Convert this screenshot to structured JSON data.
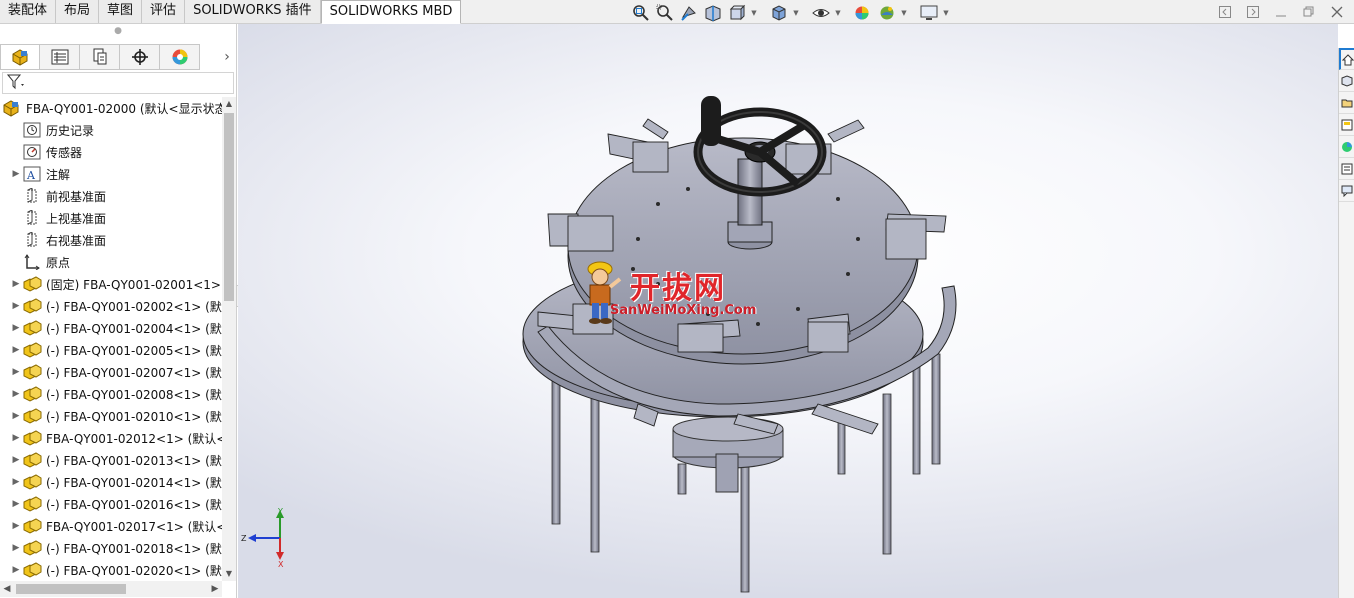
{
  "top_tabs": [
    {
      "label": "装配体",
      "active": false
    },
    {
      "label": "布局",
      "active": false
    },
    {
      "label": "草图",
      "active": false
    },
    {
      "label": "评估",
      "active": false
    },
    {
      "label": "SOLIDWORKS 插件",
      "active": false
    },
    {
      "label": "SOLIDWORKS MBD",
      "active": true
    }
  ],
  "heads_up_icons": [
    "zoom-to-fit-icon",
    "zoom-to-area-icon",
    "previous-view-icon",
    "section-view-icon",
    "view-orientation-icon",
    "display-style-icon",
    "hide-show-icon",
    "edit-appearance-icon",
    "apply-scene-icon",
    "view-settings-icon"
  ],
  "window_controls": [
    "tile-left-icon",
    "tile-right-icon",
    "minimize-icon",
    "restore-icon",
    "close-icon"
  ],
  "panel_tabs": [
    "featuremanager-icon",
    "propertymanager-icon",
    "configurationmanager-icon",
    "dimxpertmanager-icon",
    "displaymanager-icon"
  ],
  "tree": {
    "root": "FBA-QY001-02000  (默认<显示状态",
    "items": [
      {
        "label": "历史记录",
        "icon": "history-icon",
        "expandable": false
      },
      {
        "label": "传感器",
        "icon": "sensor-icon",
        "expandable": false
      },
      {
        "label": "注解",
        "icon": "annotation-icon",
        "expandable": true
      },
      {
        "label": "前视基准面",
        "icon": "plane-icon",
        "expandable": false
      },
      {
        "label": "上视基准面",
        "icon": "plane-icon",
        "expandable": false
      },
      {
        "label": "右视基准面",
        "icon": "plane-icon",
        "expandable": false
      },
      {
        "label": "原点",
        "icon": "origin-icon",
        "expandable": false
      },
      {
        "label": "(固定) FBA-QY001-02001<1> (",
        "icon": "subassembly-icon",
        "expandable": true
      },
      {
        "label": "(-) FBA-QY001-02002<1> (默认",
        "icon": "subassembly-icon",
        "expandable": true
      },
      {
        "label": "(-) FBA-QY001-02004<1> (默认",
        "icon": "subassembly-icon",
        "expandable": true
      },
      {
        "label": "(-) FBA-QY001-02005<1> (默认",
        "icon": "subassembly-icon",
        "expandable": true
      },
      {
        "label": "(-) FBA-QY001-02007<1> (默认",
        "icon": "subassembly-icon",
        "expandable": true
      },
      {
        "label": "(-) FBA-QY001-02008<1> (默认",
        "icon": "subassembly-icon",
        "expandable": true
      },
      {
        "label": "(-) FBA-QY001-02010<1> (默认",
        "icon": "subassembly-icon",
        "expandable": true
      },
      {
        "label": "FBA-QY001-02012<1> (默认<",
        "icon": "subassembly-icon",
        "expandable": true
      },
      {
        "label": "(-) FBA-QY001-02013<1> (默认",
        "icon": "subassembly-icon",
        "expandable": true
      },
      {
        "label": "(-) FBA-QY001-02014<1> (默认",
        "icon": "subassembly-icon",
        "expandable": true
      },
      {
        "label": "(-) FBA-QY001-02016<1> (默认",
        "icon": "subassembly-icon",
        "expandable": true
      },
      {
        "label": "FBA-QY001-02017<1> (默认<",
        "icon": "subassembly-icon",
        "expandable": true
      },
      {
        "label": "(-) FBA-QY001-02018<1> (默认",
        "icon": "subassembly-icon",
        "expandable": true
      },
      {
        "label": "(-) FBA-QY001-02020<1> (默认",
        "icon": "subassembly-icon",
        "expandable": true
      }
    ]
  },
  "watermark": {
    "title": "开拔网",
    "url": "SanWeiMoXing.Com"
  },
  "triad": {
    "x": "X",
    "y": "Y",
    "z": "Z"
  },
  "task_pane_icons": [
    "home-icon",
    "resources-icon",
    "design-library-icon",
    "file-explorer-icon",
    "view-palette-icon",
    "appearances-icon",
    "custom-properties-icon"
  ],
  "colors": {
    "accent": "#1f7bd1",
    "part_gray": "#a5a7b5",
    "handwheel": "#1c1c1c",
    "watermark_red": "#e0252a"
  }
}
